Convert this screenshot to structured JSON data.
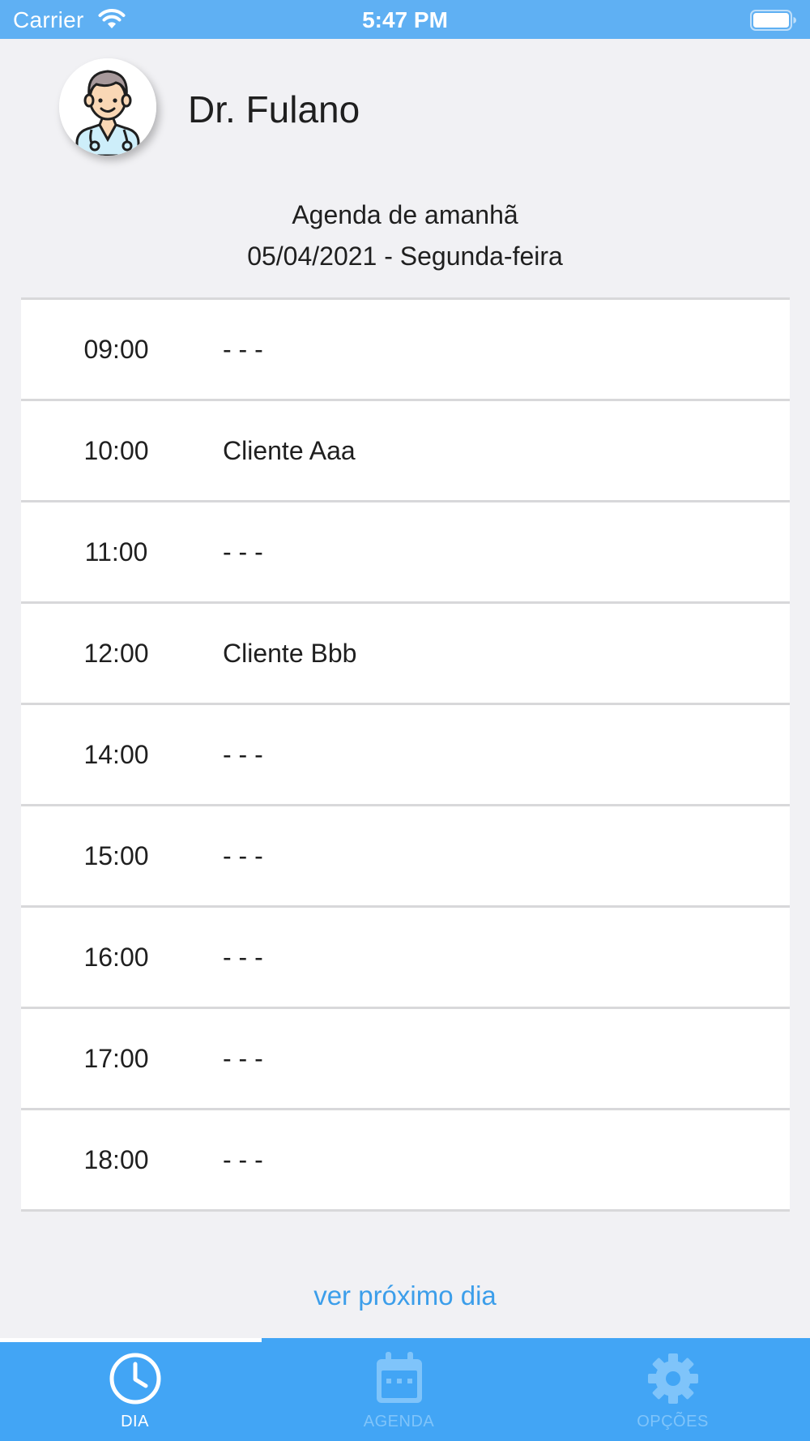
{
  "status_bar": {
    "carrier": "Carrier",
    "time": "5:47 PM"
  },
  "profile": {
    "name": "Dr. Fulano",
    "avatar_icon": "doctor-avatar-icon"
  },
  "agenda": {
    "title": "Agenda de amanhã",
    "date": "05/04/2021 - Segunda-feira",
    "rows": [
      {
        "time": "09:00",
        "client": "- - -"
      },
      {
        "time": "10:00",
        "client": "Cliente Aaa"
      },
      {
        "time": "11:00",
        "client": "- - -"
      },
      {
        "time": "12:00",
        "client": "Cliente Bbb"
      },
      {
        "time": "14:00",
        "client": "- - -"
      },
      {
        "time": "15:00",
        "client": "- - -"
      },
      {
        "time": "16:00",
        "client": "- - -"
      },
      {
        "time": "17:00",
        "client": "- - -"
      },
      {
        "time": "18:00",
        "client": "- - -"
      }
    ]
  },
  "next_day_link": "ver próximo dia",
  "tabs": [
    {
      "label": "DIA",
      "icon": "clock-icon",
      "active": true
    },
    {
      "label": "AGENDA",
      "icon": "calendar-icon",
      "active": false
    },
    {
      "label": "OPÇÕES",
      "icon": "gear-icon",
      "active": false
    }
  ],
  "colors": {
    "accent": "#42a5f5",
    "status_bar": "#5fb0f3",
    "link": "#3c9eea",
    "background": "#f1f1f4"
  }
}
